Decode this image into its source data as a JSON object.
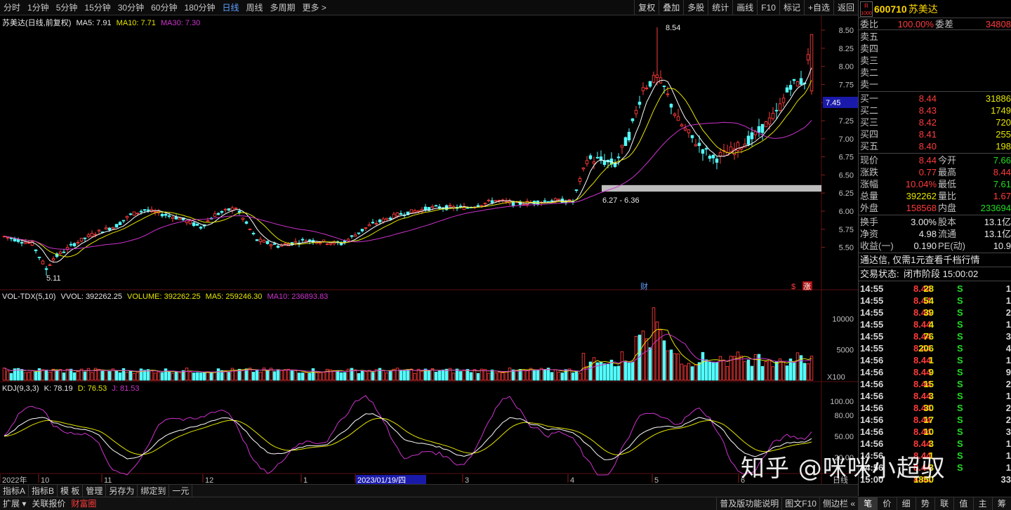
{
  "toolbar": {
    "periods": [
      "分时",
      "1分钟",
      "5分钟",
      "15分钟",
      "30分钟",
      "60分钟",
      "180分钟",
      "日线",
      "周线",
      "多周期",
      "更多 >"
    ],
    "active_period": "日线",
    "right_buttons": [
      "复权",
      "叠加",
      "多股",
      "统计",
      "画线",
      "F10",
      "标记",
      "+自选",
      "返回"
    ]
  },
  "main_chart": {
    "title": "苏美达(日线,前复权)",
    "ma5_label": "MA5: 7.91",
    "ma10_label": "MA10: 7.71",
    "ma30_label": "MA30: 7.30",
    "price_ticks": [
      "8.50",
      "8.25",
      "8.00",
      "7.75",
      "7.50",
      "7.25",
      "7.00",
      "6.75",
      "6.50",
      "6.25",
      "6.00",
      "5.75",
      "5.50"
    ],
    "current_price_tag": "7.45",
    "high_annotation": "8.54",
    "low_annotation": "5.11",
    "range_annotation": "6.27 - 6.36",
    "cai_marker": "财",
    "zhang_marker": "涨",
    "dollar_marker": "$"
  },
  "volume_chart": {
    "title": "VOL-TDX(5,10)",
    "vvol_label": "VVOL: 392262.25",
    "volume_label": "VOLUME: 392262.25",
    "ma5_label": "MA5: 259246.30",
    "ma10_label": "MA10: 236893.83",
    "ticks": [
      "10000",
      "5000",
      "X100"
    ]
  },
  "kdj_chart": {
    "title": "KDJ(9,3,3)",
    "k_label": "K: 78.19",
    "d_label": "D: 76.53",
    "j_label": "J: 81.53",
    "ticks": [
      "100.00",
      "80.00",
      "50.00",
      "20.00"
    ]
  },
  "time_axis": {
    "labels": [
      "2022年",
      "10",
      "11",
      "12",
      "1",
      "2023/01/19/四",
      "3",
      "4",
      "5",
      "6"
    ],
    "right_label": "日线"
  },
  "colors": {
    "up": "#ff3b3b",
    "down": "#54ffff",
    "ma5": "#ffffff",
    "ma10": "#e6e600",
    "ma30": "#cc33cc",
    "bg": "#000000"
  },
  "chart_data": {
    "type": "candlestick",
    "x_range": [
      "2022-08",
      "2023-06"
    ],
    "ylim": [
      5.0,
      8.6
    ],
    "key_points": [
      {
        "label": "low",
        "value": 5.11
      },
      {
        "label": "high",
        "value": 8.54
      },
      {
        "label": "current",
        "value": 8.44
      }
    ],
    "ma": {
      "MA5": 7.91,
      "MA10": 7.71,
      "MA30": 7.3
    }
  },
  "quote": {
    "rbox_top": "R",
    "rbox_bottom": "1000",
    "code": "600710",
    "name": "苏美达",
    "weibi_label": "委比",
    "weibi_value": "100.00%",
    "weicha_label": "委差",
    "weicha_value": "34808",
    "sells": [
      "卖五",
      "卖四",
      "卖三",
      "卖二",
      "卖一"
    ],
    "buys": [
      {
        "label": "买一",
        "price": "8.44",
        "vol": "31886"
      },
      {
        "label": "买二",
        "price": "8.43",
        "vol": "1749"
      },
      {
        "label": "买三",
        "price": "8.42",
        "vol": "720"
      },
      {
        "label": "买四",
        "price": "8.41",
        "vol": "255"
      },
      {
        "label": "买五",
        "price": "8.40",
        "vol": "198"
      }
    ],
    "stats": [
      {
        "l1": "现价",
        "v1": "8.44",
        "c1": "red",
        "l2": "今开",
        "v2": "7.66",
        "c2": "green"
      },
      {
        "l1": "涨跌",
        "v1": "0.77",
        "c1": "red",
        "l2": "最高",
        "v2": "8.44",
        "c2": "red"
      },
      {
        "l1": "涨幅",
        "v1": "10.04%",
        "c1": "red",
        "l2": "最低",
        "v2": "7.61",
        "c2": "green"
      },
      {
        "l1": "总量",
        "v1": "392262",
        "c1": "yellow",
        "l2": "量比",
        "v2": "1.67",
        "c2": "red"
      },
      {
        "l1": "外盘",
        "v1": "158568",
        "c1": "red",
        "l2": "内盘",
        "v2": "233694",
        "c2": "green"
      }
    ],
    "stats2": [
      {
        "l1": "换手",
        "v1": "3.00%",
        "l2": "股本",
        "v2": "13.1亿"
      },
      {
        "l1": "净资",
        "v1": "4.98",
        "l2": "流通",
        "v2": "13.1亿"
      },
      {
        "l1": "收益(一)",
        "v1": "0.190",
        "l2": "PE(动)",
        "v2": "10.9"
      }
    ],
    "promo": "通达信, 仅需1元查看千档行情",
    "trade_status_label": "交易状态:",
    "trade_status_value": "闭市阶段 15:00:02",
    "ticks": [
      {
        "t": "14:55",
        "p": "8.44",
        "v": "28",
        "s": "S",
        "n": "1"
      },
      {
        "t": "14:55",
        "p": "8.44",
        "v": "54",
        "s": "S",
        "n": "1"
      },
      {
        "t": "14:55",
        "p": "8.44",
        "v": "39",
        "s": "S",
        "n": "2"
      },
      {
        "t": "14:55",
        "p": "8.44",
        "v": "4",
        "s": "S",
        "n": "1"
      },
      {
        "t": "14:55",
        "p": "8.44",
        "v": "76",
        "s": "S",
        "n": "3"
      },
      {
        "t": "14:55",
        "p": "8.44",
        "v": "206",
        "s": "S",
        "n": "4"
      },
      {
        "t": "14:56",
        "p": "8.44",
        "v": "1",
        "s": "S",
        "n": "1"
      },
      {
        "t": "14:56",
        "p": "8.44",
        "v": "9",
        "s": "S",
        "n": "9"
      },
      {
        "t": "14:56",
        "p": "8.44",
        "v": "15",
        "s": "S",
        "n": "2"
      },
      {
        "t": "14:56",
        "p": "8.44",
        "v": "3",
        "s": "S",
        "n": "1"
      },
      {
        "t": "14:56",
        "p": "8.44",
        "v": "30",
        "s": "S",
        "n": "2"
      },
      {
        "t": "14:56",
        "p": "8.44",
        "v": "17",
        "s": "S",
        "n": "2"
      },
      {
        "t": "14:56",
        "p": "8.44",
        "v": "10",
        "s": "S",
        "n": "3"
      },
      {
        "t": "14:56",
        "p": "8.44",
        "v": "3",
        "s": "S",
        "n": "1"
      },
      {
        "t": "14:56",
        "p": "8.44",
        "v": "1",
        "s": "S",
        "n": "1"
      },
      {
        "t": "14:56",
        "p": "8.44",
        "v": "3",
        "s": "S",
        "n": "1"
      },
      {
        "t": "15:00",
        "p": "8.44",
        "v": "1850",
        "s": "",
        "n": "33"
      }
    ]
  },
  "bottombar": [
    "指标A",
    "指标B",
    "模 板",
    "管理",
    "另存为",
    "绑定到",
    "一元"
  ],
  "statusbar": {
    "left": [
      "扩展 ▾",
      "关联报价"
    ],
    "left_red": "财富圈",
    "right": [
      "普及版功能说明",
      "图文F10",
      "侧边栏 «"
    ]
  },
  "rp_tabs": [
    "笔",
    "价",
    "细",
    "势",
    "联",
    "值",
    "主",
    "筹"
  ],
  "watermark": "知乎 @咪咪小超驭"
}
